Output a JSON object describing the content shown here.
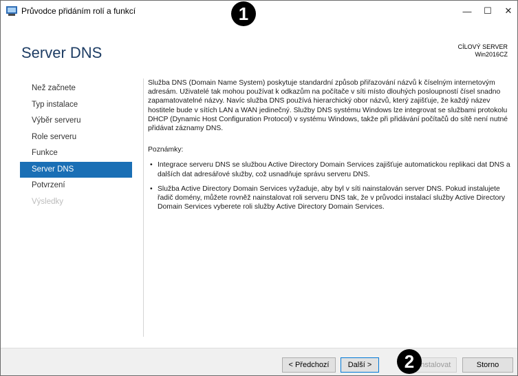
{
  "window": {
    "title": "Průvodce přidáním rolí a funkcí",
    "controls": {
      "minimize": "—",
      "maximize": "☐",
      "close": "✕"
    }
  },
  "markers": {
    "one": "1",
    "two": "2"
  },
  "header": {
    "title": "Server DNS",
    "target_label": "CÍLOVÝ SERVER",
    "target_name": "Win2016CZ"
  },
  "nav": {
    "items": [
      {
        "label": "Než začnete",
        "state": "normal"
      },
      {
        "label": "Typ instalace",
        "state": "normal"
      },
      {
        "label": "Výběr serveru",
        "state": "normal"
      },
      {
        "label": "Role serveru",
        "state": "normal"
      },
      {
        "label": "Funkce",
        "state": "normal"
      },
      {
        "label": "Server DNS",
        "state": "active"
      },
      {
        "label": "Potvrzení",
        "state": "normal"
      },
      {
        "label": "Výsledky",
        "state": "disabled"
      }
    ]
  },
  "content": {
    "intro": "Služba DNS (Domain Name System) poskytuje standardní způsob přiřazování názvů k číselným internetovým adresám. Uživatelé tak mohou používat k odkazům na počítače v síti místo dlouhých posloupností čísel snadno zapamatovatelné názvy. Navíc služba DNS používá hierarchický obor názvů, který zajišťuje, že každý název hostitele bude v sítích LAN a WAN jedinečný. Služby DNS systému Windows lze integrovat se službami protokolu DHCP (Dynamic Host Configuration Protocol) v systému Windows, takže při přidávání počítačů do sítě není nutné přidávat záznamy DNS.",
    "notes_heading": "Poznámky:",
    "notes": [
      "Integrace serveru DNS se službou Active Directory Domain Services zajišťuje automatickou replikaci dat DNS a dalších dat adresářové služby, což usnadňuje správu serveru DNS.",
      "Služba Active Directory Domain Services vyžaduje, aby byl v síti nainstalován server DNS. Pokud instalujete řadič domény, můžete rovněž nainstalovat roli serveru DNS tak, že v průvodci instalací služby Active Directory Domain Services vyberete roli služby Active Directory Domain Services."
    ]
  },
  "footer": {
    "prev": "< Předchozí",
    "next": "Další >",
    "install": "Nainstalovat",
    "cancel": "Storno"
  },
  "colors": {
    "accent": "#1a6fb5",
    "header_title": "#1e3d64"
  }
}
